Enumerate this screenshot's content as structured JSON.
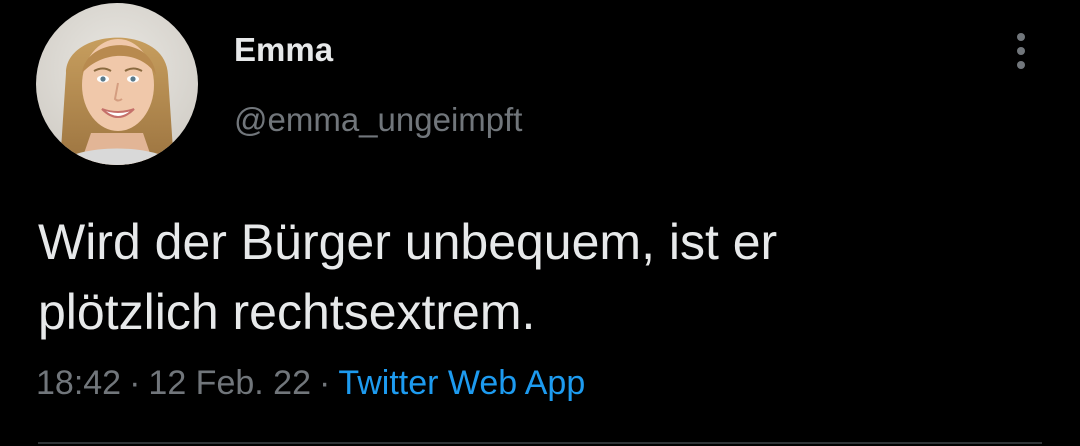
{
  "tweet": {
    "author": {
      "display_name": "Emma",
      "handle": "@emma_ungeimpft",
      "avatar_icon": "profile-photo"
    },
    "more_icon": "more-vertical-icon",
    "text": "Wird der Bürger unbequem, ist er\nplötzlich rechtsextrem.",
    "time": "18:42",
    "separator": "·",
    "date": "12 Feb. 22",
    "source": "Twitter Web App"
  },
  "colors": {
    "background": "#000000",
    "primary_text": "#e7e9ea",
    "secondary_text": "#71767b",
    "link": "#1d9bf0",
    "divider": "#2f3336"
  }
}
